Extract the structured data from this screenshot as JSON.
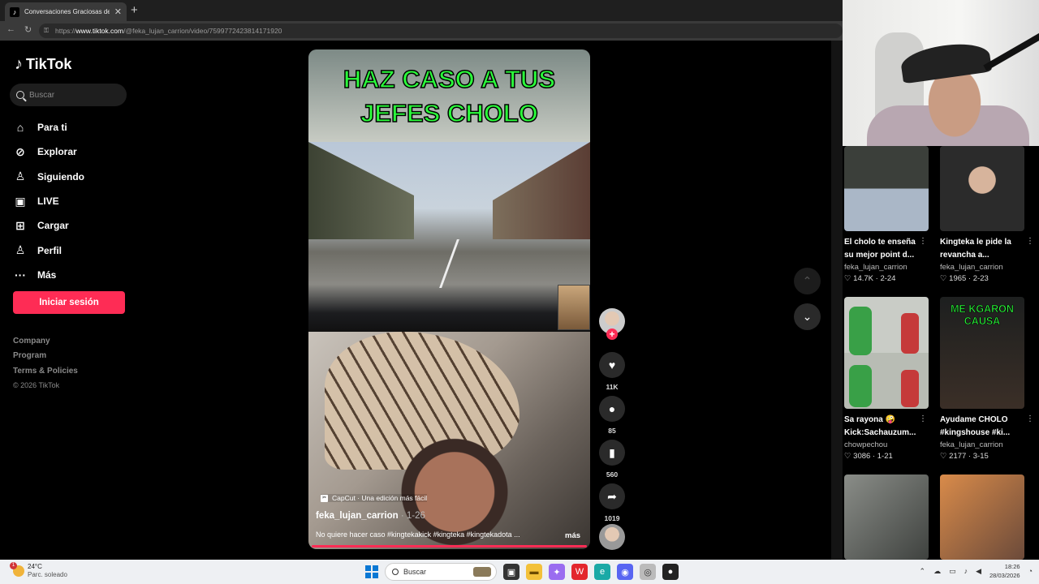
{
  "browser": {
    "tab_title": "Conversaciones Graciosas de Kingteka",
    "tab_favicon": "tiktok-icon",
    "new_tab": "+",
    "close_tab": "✕",
    "url_prefix": "https://",
    "url_host": "www.tiktok.com",
    "url_path": "/@feka_lujan_carrion/video/7599772423814171920"
  },
  "sidebar": {
    "logo": "TikTok",
    "search_placeholder": "Buscar",
    "items": [
      {
        "label": "Para ti",
        "icon": "home-icon"
      },
      {
        "label": "Explorar",
        "icon": "compass-icon"
      },
      {
        "label": "Siguiendo",
        "icon": "following-icon"
      },
      {
        "label": "LIVE",
        "icon": "live-icon"
      },
      {
        "label": "Cargar",
        "icon": "upload-icon"
      },
      {
        "label": "Perfil",
        "icon": "profile-icon"
      },
      {
        "label": "Más",
        "icon": "more-icon"
      }
    ],
    "login": "Iniciar sesión",
    "footer": [
      "Company",
      "Program",
      "Terms & Policies"
    ],
    "copyright": "© 2026 TikTok"
  },
  "video": {
    "overlay_title": "HAZ CASO A TUS JEFES CHOLO",
    "capcut": "CapCut · Una edición más fácil",
    "author": "feka_lujan_carrion",
    "date": "· 1-26",
    "description": "No quiere hacer caso #kingtekakick #kingteka #kingtekadota ...",
    "more": "más",
    "progress": 1.0
  },
  "actions": {
    "likes": "11K",
    "comments": "85",
    "saves": "560",
    "shares": "1019"
  },
  "grid": [
    {
      "title": "El cholo te enseña su mejor point d...",
      "author": "feka_lujan_carrion",
      "likes": "14.7K",
      "date": "2-24",
      "overlay": ""
    },
    {
      "title": "Kingteka le pide la revancha a...",
      "author": "feka_lujan_carrion",
      "likes": "1965",
      "date": "2-23",
      "overlay": ""
    },
    {
      "title": "Sa rayona 🤪 Kick:Sachauzum...",
      "author": "chowpechou",
      "likes": "3086",
      "date": "1-21",
      "overlay": ""
    },
    {
      "title": "Ayudame CHOLO #kingshouse #ki...",
      "author": "feka_lujan_carrion",
      "likes": "2177",
      "date": "3-15",
      "overlay": "ME KGARON CAUSA"
    }
  ],
  "taskbar": {
    "temp": "24°C",
    "weather": "Parc. soleado",
    "weather_badge": "1",
    "search": "Buscar",
    "time": "18:26",
    "date": "28/03/2026"
  },
  "colors": {
    "accent": "#fe2c55",
    "overlay_text": "#2bff3b"
  }
}
